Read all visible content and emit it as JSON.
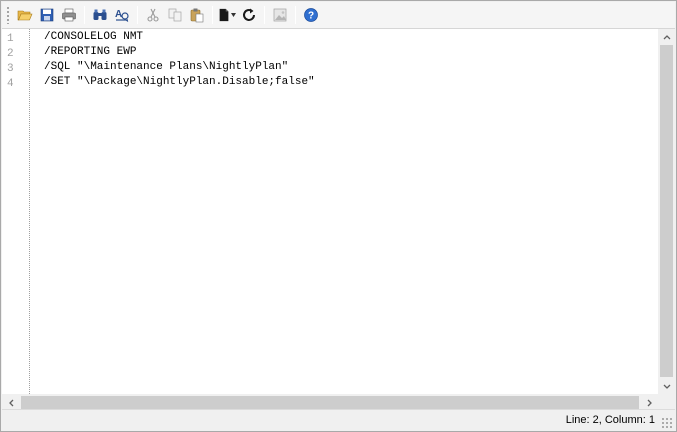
{
  "toolbar": {
    "buttons": [
      {
        "icon": "open-folder-icon"
      },
      {
        "icon": "save-icon"
      },
      {
        "icon": "print-icon"
      },
      {
        "icon": "find-icon"
      },
      {
        "icon": "find-replace-icon"
      },
      {
        "icon": "cut-icon"
      },
      {
        "icon": "copy-icon"
      },
      {
        "icon": "paste-icon"
      },
      {
        "icon": "new-document-icon"
      },
      {
        "icon": "refresh-icon"
      },
      {
        "icon": "image-icon"
      },
      {
        "icon": "help-icon"
      }
    ]
  },
  "editor": {
    "lines": [
      {
        "number": "1",
        "text": "/CONSOLELOG NMT"
      },
      {
        "number": "2",
        "text": "/REPORTING EWP"
      },
      {
        "number": "3",
        "text": "/SQL \"\\Maintenance Plans\\NightlyPlan\""
      },
      {
        "number": "4",
        "text": "/SET \"\\Package\\NightlyPlan.Disable;false\""
      }
    ]
  },
  "status": {
    "position": "Line: 2, Column: 1"
  },
  "colors": {
    "accent": "#1f5fbf",
    "gutter_text": "#a0a0a0",
    "scroll_thumb": "#cdcdcd"
  }
}
